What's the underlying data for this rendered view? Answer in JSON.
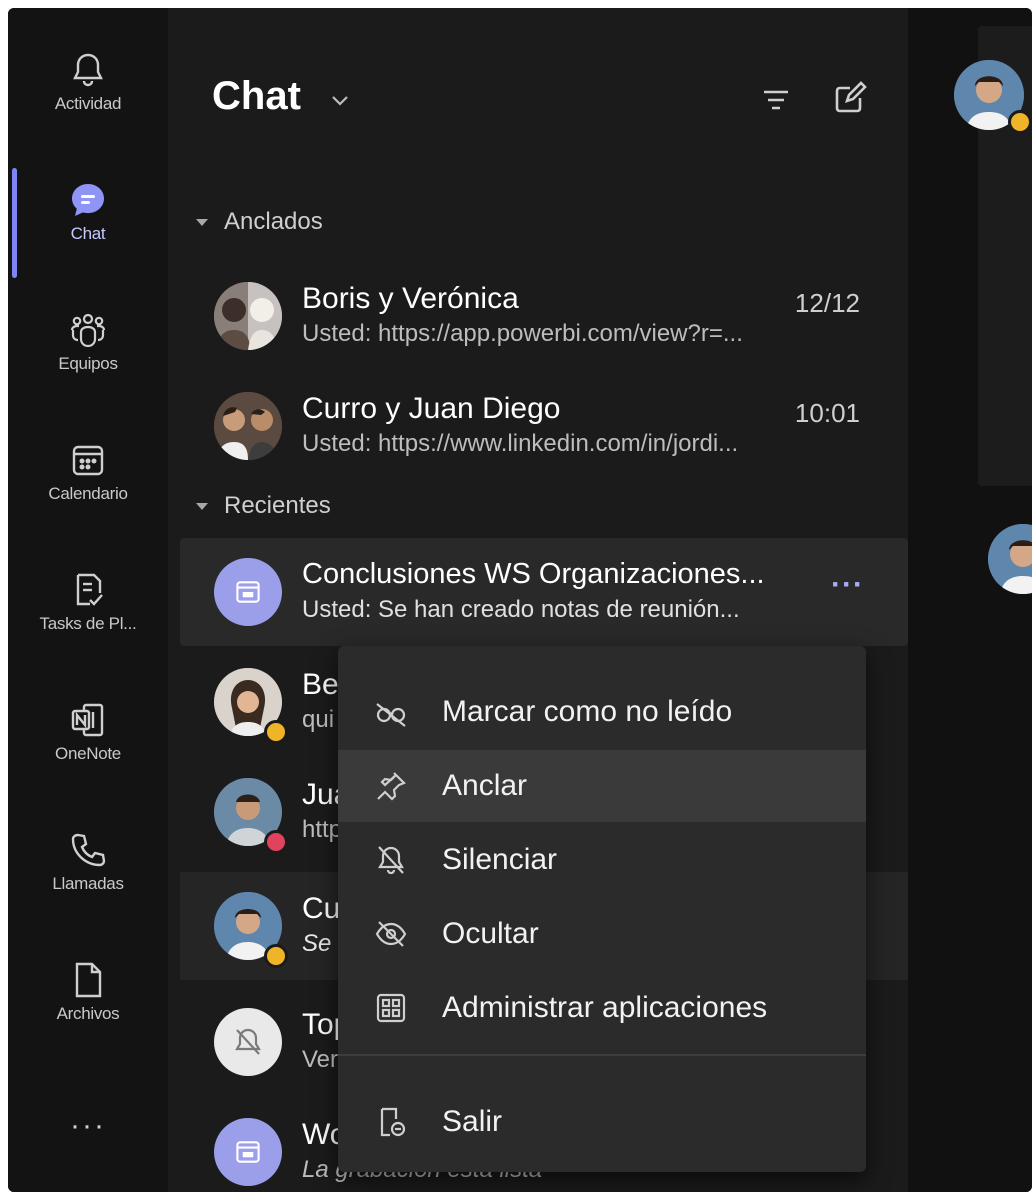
{
  "rail": {
    "items": [
      {
        "label": "Actividad",
        "icon": "bell-icon"
      },
      {
        "label": "Chat",
        "icon": "chat-icon",
        "active": true
      },
      {
        "label": "Equipos",
        "icon": "teams-icon"
      },
      {
        "label": "Calendario",
        "icon": "calendar-icon"
      },
      {
        "label": "Tasks de Pl...",
        "icon": "tasks-icon"
      },
      {
        "label": "OneNote",
        "icon": "onenote-icon"
      },
      {
        "label": "Llamadas",
        "icon": "phone-icon"
      },
      {
        "label": "Archivos",
        "icon": "file-icon"
      }
    ],
    "more": "···"
  },
  "chat": {
    "title": "Chat",
    "pinned_label": "Anclados",
    "recent_label": "Recientes",
    "pinned": [
      {
        "name": "Boris y Verónica",
        "preview": "Usted: https://app.powerbi.com/view?r=...",
        "time": "12/12"
      },
      {
        "name": "Curro y Juan Diego",
        "preview": "Usted: https://www.linkedin.com/in/jordi...",
        "time": "10:01"
      }
    ],
    "recent": [
      {
        "name": "Conclusiones WS Organizaciones...",
        "preview": "Usted: Se han creado notas de reunión...",
        "more": "···"
      },
      {
        "name": "Bel",
        "preview": "qui"
      },
      {
        "name": "Jua",
        "preview": "http"
      },
      {
        "name": "Cu",
        "preview": "Se l"
      },
      {
        "name": "Top",
        "preview": "Ver"
      },
      {
        "name": "Wo",
        "preview": "La grabación está lista"
      }
    ]
  },
  "menu": {
    "items": [
      {
        "label": "Marcar como no leído",
        "icon": "unread-glasses-icon"
      },
      {
        "label": "Anclar",
        "icon": "pin-icon"
      },
      {
        "label": "Silenciar",
        "icon": "mute-bell-icon"
      },
      {
        "label": "Ocultar",
        "icon": "hide-eye-icon"
      },
      {
        "label": "Administrar aplicaciones",
        "icon": "apps-grid-icon"
      },
      {
        "label": "Salir",
        "icon": "leave-icon"
      }
    ]
  },
  "colors": {
    "accent": "#7f85f5",
    "away": "#f0b429",
    "busy": "#e0445c",
    "background": "#1b1b1b",
    "menu": "#2b2b2b"
  }
}
